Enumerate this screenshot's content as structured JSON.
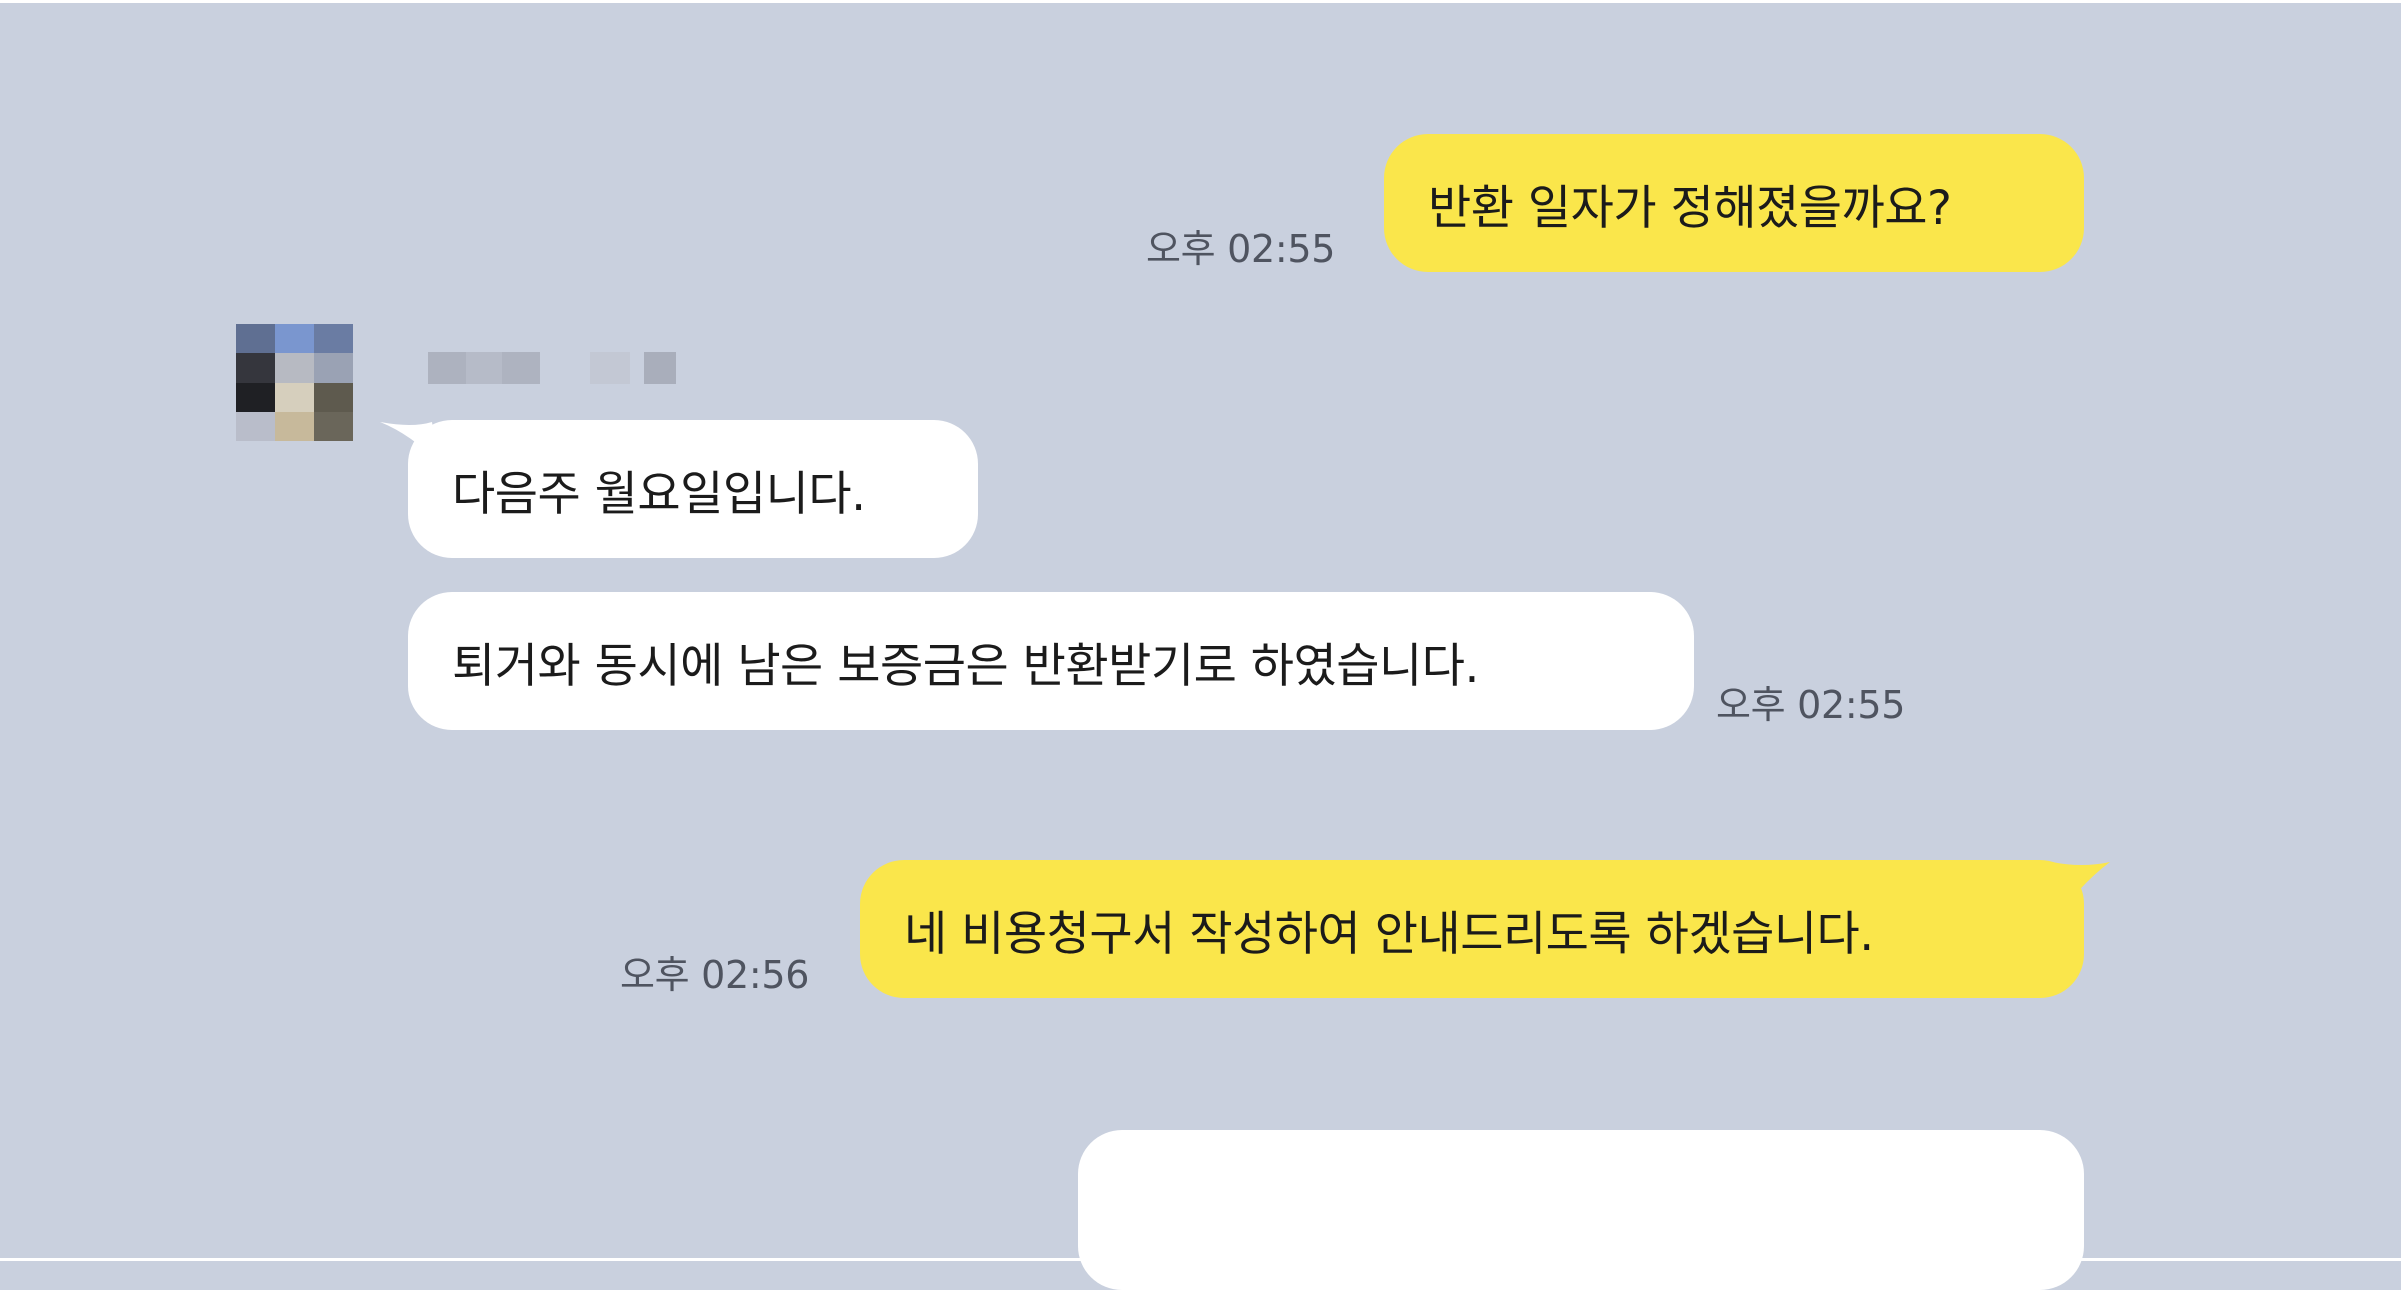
{
  "chat": {
    "sender": {
      "name": ""
    },
    "messages": [
      {
        "direction": "outgoing",
        "text": "반환 일자가 정해졌을까요?",
        "time": "오후 02:55"
      },
      {
        "direction": "incoming",
        "text": "다음주 월요일입니다."
      },
      {
        "direction": "incoming",
        "text": "퇴거와 동시에 남은 보증금은 반환받기로 하였습니다.",
        "time": "오후 02:55"
      },
      {
        "direction": "outgoing",
        "text": "네 비용청구서 작성하여 안내드리도록 하겠습니다.",
        "time": "오후 02:56"
      },
      {
        "direction": "incoming",
        "text": ""
      }
    ]
  },
  "colors": {
    "background": "#c9d0de",
    "outgoing_bubble": "#fae64b",
    "incoming_bubble": "#ffffff",
    "timestamp": "#4f5460"
  }
}
